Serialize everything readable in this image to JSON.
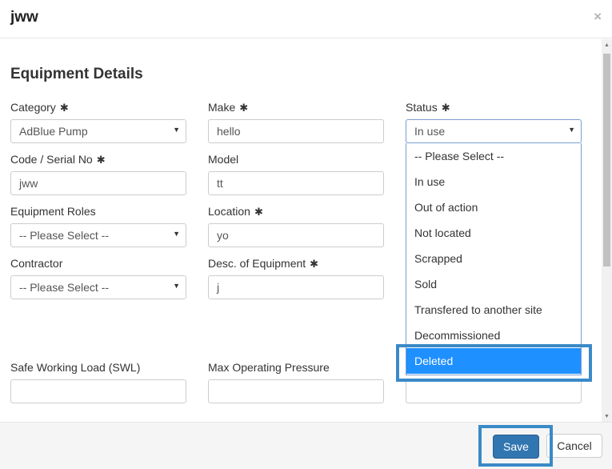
{
  "modal": {
    "title": "jww",
    "close_glyph": "×"
  },
  "section": {
    "title": "Equipment Details"
  },
  "required_glyph": "✱",
  "fields": {
    "category": {
      "label": "Category",
      "value": "AdBlue Pump"
    },
    "make": {
      "label": "Make",
      "value": "hello"
    },
    "status": {
      "label": "Status",
      "value": "In use"
    },
    "code": {
      "label": "Code / Serial No",
      "value": "jww"
    },
    "model": {
      "label": "Model",
      "value": "tt"
    },
    "roles": {
      "label": "Equipment Roles",
      "value": "-- Please Select --"
    },
    "location": {
      "label": "Location",
      "value": "yo"
    },
    "contractor": {
      "label": "Contractor",
      "value": "-- Please Select --"
    },
    "desc": {
      "label": "Desc. of Equipment",
      "value": "j"
    },
    "swl": {
      "label": "Safe Working Load (SWL)",
      "value": ""
    },
    "mop": {
      "label": "Max Operating Pressure",
      "value": ""
    }
  },
  "status_options": [
    "-- Please Select --",
    "In use",
    "Out of action",
    "Not located",
    "Scrapped",
    "Sold",
    "Transfered to another site",
    "Decommissioned",
    "Deleted"
  ],
  "status_highlighted": "Deleted",
  "footer": {
    "save_label": "Save",
    "cancel_label": "Cancel"
  },
  "colors": {
    "primary": "#3276b1",
    "option_hover": "#1e90ff",
    "highlight_frame": "#3a8ac8"
  }
}
